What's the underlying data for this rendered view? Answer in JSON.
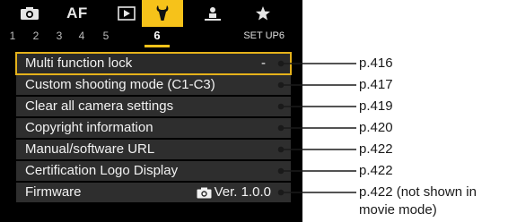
{
  "tabs": [
    {
      "icon": "camera-icon"
    },
    {
      "label": "AF"
    },
    {
      "icon": "playback-icon"
    },
    {
      "icon": "setup-wrench-icon"
    },
    {
      "icon": "custom-functions-icon"
    },
    {
      "icon": "my-menu-star-icon"
    }
  ],
  "pages": [
    "1",
    "2",
    "3",
    "4",
    "5",
    "6"
  ],
  "active_page": "6",
  "page_label": "SET UP6",
  "menu_items": [
    {
      "label": "Multi function lock",
      "value": "-",
      "ref": "p.416"
    },
    {
      "label": "Custom shooting mode (C1-C3)",
      "ref": "p.417"
    },
    {
      "label": "Clear all camera settings",
      "ref": "p.419"
    },
    {
      "label": "Copyright information",
      "ref": "p.420"
    },
    {
      "label": "Manual/software URL",
      "ref": "p.422"
    },
    {
      "label": "Certification Logo Display",
      "ref": "p.422"
    },
    {
      "label": "Firmware",
      "value": "Ver. 1.0.0",
      "value_icon": "camera-icon",
      "ref": "p.422 (not shown in",
      "ref_line2": "movie mode)"
    }
  ],
  "colors": {
    "accent": "#f6c21a",
    "screen_bg": "#000000",
    "row_bg": "#2e2e2e"
  }
}
